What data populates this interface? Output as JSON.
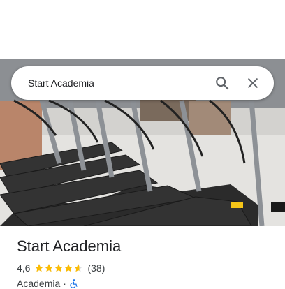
{
  "search": {
    "query": "Start Academia"
  },
  "place": {
    "name": "Start Academia",
    "rating": "4,6",
    "rating_value": 4.6,
    "review_count": "(38)",
    "category": "Academia",
    "separator": "·"
  },
  "icons": {
    "search": "search-icon",
    "close": "close-icon",
    "accessibility": "wheelchair-icon",
    "star": "star-icon"
  },
  "colors": {
    "star": "#fbbc04",
    "accessibility": "#1a73e8"
  }
}
